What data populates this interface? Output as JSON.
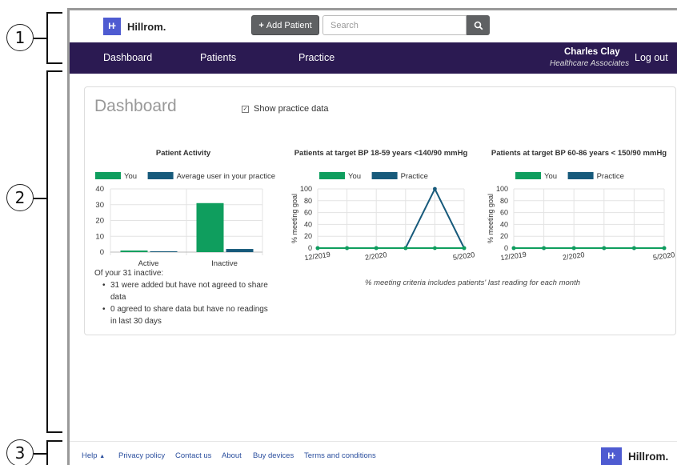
{
  "callouts": [
    "1",
    "2",
    "3"
  ],
  "brand": {
    "name": "Hillrom.",
    "mark": "H·",
    "color": "#4e5bd1"
  },
  "topbar": {
    "add_patient_label": "Add Patient",
    "search_placeholder": "Search"
  },
  "nav": {
    "items": [
      "Dashboard",
      "Patients",
      "Practice"
    ],
    "user_name": "Charles Clay",
    "user_org": "Healthcare Associates",
    "logout_label": "Log out",
    "bg_color": "#2b1a52"
  },
  "dashboard": {
    "title": "Dashboard",
    "show_practice_label": "Show practice data",
    "inactive_note": {
      "heading": "Of your 31 inactive:",
      "items": [
        "31 were added but have not agreed to share data",
        "0 agreed to share data but have no readings in last 30 days"
      ]
    },
    "caption": "% meeting criteria includes patients' last reading for each month"
  },
  "chart_data": [
    {
      "type": "bar",
      "title": "Patient Activity",
      "categories": [
        "Active",
        "Inactive"
      ],
      "series": [
        {
          "name": "You",
          "color": "#0f9e5e",
          "values": [
            1,
            31
          ]
        },
        {
          "name": "Average user in your practice",
          "color": "#175a7b",
          "values": [
            0.5,
            2
          ]
        }
      ],
      "ylim": [
        0,
        40
      ],
      "yticks": [
        0,
        10,
        20,
        30,
        40
      ],
      "grid": true,
      "legend": "top"
    },
    {
      "type": "line",
      "title": "Patients at target BP 18-59 years <140/90 mmHg",
      "ylabel": "% meeting goal",
      "x": [
        "12/2019",
        "1/2020",
        "2/2020",
        "3/2020",
        "4/2020",
        "5/2020"
      ],
      "xtick_labels": [
        "12/2019",
        "2/2020",
        "5/2020"
      ],
      "series": [
        {
          "name": "You",
          "color": "#0f9e5e",
          "values": [
            0,
            0,
            0,
            0,
            0,
            0
          ]
        },
        {
          "name": "Practice",
          "color": "#175a7b",
          "values": [
            0,
            0,
            0,
            0,
            100,
            0
          ]
        }
      ],
      "ylim": [
        0,
        100
      ],
      "yticks": [
        0,
        20,
        40,
        60,
        80,
        100
      ],
      "grid": true,
      "legend": "top"
    },
    {
      "type": "line",
      "title": "Patients at target BP 60-86 years < 150/90 mmHg",
      "ylabel": "% meeting goal",
      "x": [
        "12/2019",
        "1/2020",
        "2/2020",
        "3/2020",
        "4/2020",
        "5/2020"
      ],
      "xtick_labels": [
        "12/2019",
        "2/2020",
        "5/2020"
      ],
      "series": [
        {
          "name": "You",
          "color": "#0f9e5e",
          "values": [
            0,
            0,
            0,
            0,
            0,
            0
          ]
        },
        {
          "name": "Practice",
          "color": "#175a7b",
          "values": [
            0,
            0,
            0,
            0,
            0,
            0
          ]
        }
      ],
      "ylim": [
        0,
        100
      ],
      "yticks": [
        0,
        20,
        40,
        60,
        80,
        100
      ],
      "grid": true,
      "legend": "top"
    }
  ],
  "footer": {
    "links": [
      "Help",
      "Privacy policy",
      "Contact us",
      "About",
      "Buy devices",
      "Terms and conditions"
    ]
  }
}
